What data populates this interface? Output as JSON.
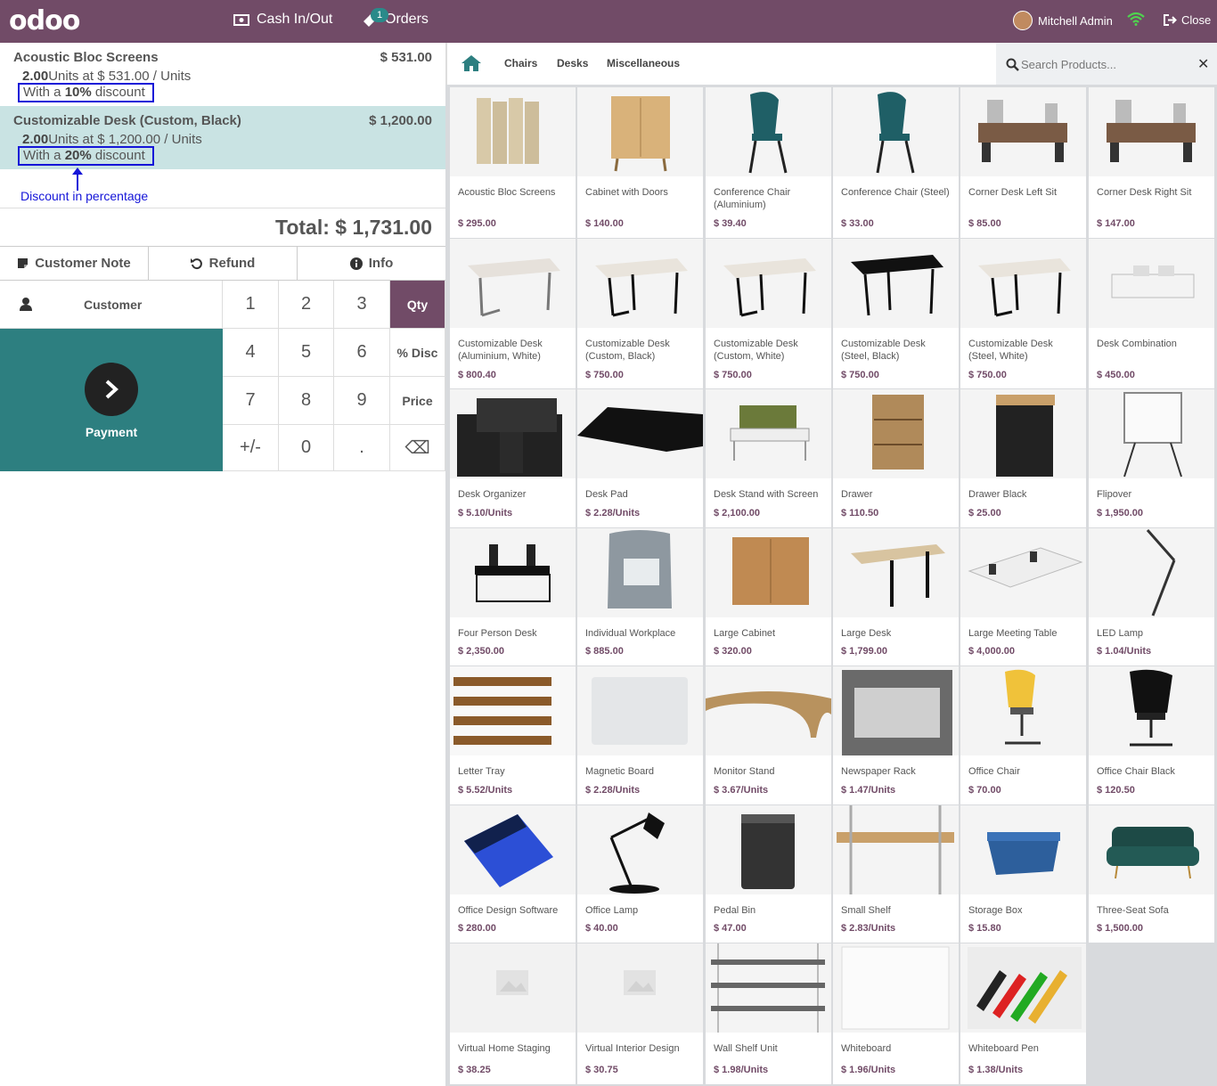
{
  "header": {
    "logo": "odoo",
    "cash_label": "Cash In/Out",
    "orders_label": "Orders",
    "orders_badge": "1",
    "user_name": "Mitchell Admin",
    "close_label": "Close",
    "brand_color": "#714B67"
  },
  "order": {
    "lines": [
      {
        "name": "Acoustic Bloc Screens",
        "price": "$ 531.00",
        "qty": "2.00",
        "info_rest": "Units at $ 531.00 / Units",
        "disc_prefix": "With a ",
        "disc_value": "10%",
        "disc_suffix": " discount"
      },
      {
        "name": "Customizable Desk (Custom, Black)",
        "price": "$ 1,200.00",
        "qty": "2.00",
        "info_rest": "Units at $ 1,200.00 / Units",
        "disc_prefix": "With a ",
        "disc_value": "20%",
        "disc_suffix": " discount"
      }
    ],
    "annotation": "Discount in percentage",
    "total": "Total: $ 1,731.00"
  },
  "controls": {
    "customer_note": "Customer Note",
    "refund": "Refund",
    "info": "Info",
    "customer": "Customer",
    "payment": "Payment"
  },
  "numpad": {
    "keys": [
      "1",
      "2",
      "3",
      "Qty",
      "4",
      "5",
      "6",
      "% Disc",
      "7",
      "8",
      "9",
      "Price",
      "+/-",
      "0",
      ".",
      "⌫"
    ],
    "active_mode": "Qty"
  },
  "categories": [
    "Chairs",
    "Desks",
    "Miscellaneous"
  ],
  "search": {
    "placeholder": "Search Products..."
  },
  "products": [
    {
      "name": "Acoustic Bloc Screens",
      "price": "$ 295.00",
      "icon": "screens"
    },
    {
      "name": "Cabinet with Doors",
      "price": "$ 140.00",
      "icon": "cabinet"
    },
    {
      "name": "Conference Chair (Aluminium)",
      "price": "$ 39.40",
      "icon": "chair-teal"
    },
    {
      "name": "Conference Chair (Steel)",
      "price": "$ 33.00",
      "icon": "chair-teal"
    },
    {
      "name": "Corner Desk Left Sit",
      "price": "$ 85.00",
      "icon": "corner-desk"
    },
    {
      "name": "Corner Desk Right Sit",
      "price": "$ 147.00",
      "icon": "corner-desk"
    },
    {
      "name": "Customizable Desk (Aluminium, White)",
      "price": "$ 800.40",
      "icon": "desk-grey"
    },
    {
      "name": "Customizable Desk (Custom, Black)",
      "price": "$ 750.00",
      "icon": "desk-black-legs"
    },
    {
      "name": "Customizable Desk (Custom, White)",
      "price": "$ 750.00",
      "icon": "desk-black-legs"
    },
    {
      "name": "Customizable Desk (Steel, Black)",
      "price": "$ 750.00",
      "icon": "desk-black"
    },
    {
      "name": "Customizable Desk (Steel, White)",
      "price": "$ 750.00",
      "icon": "desk-black-legs"
    },
    {
      "name": "Desk Combination",
      "price": "$ 450.00",
      "icon": "desk-combo"
    },
    {
      "name": "Desk Organizer",
      "price": "$ 5.10/Units",
      "icon": "organizer"
    },
    {
      "name": "Desk Pad",
      "price": "$ 2.28/Units",
      "icon": "desk-pad"
    },
    {
      "name": "Desk Stand with Screen",
      "price": "$ 2,100.00",
      "icon": "desk-stand"
    },
    {
      "name": "Drawer",
      "price": "$ 110.50",
      "icon": "drawer"
    },
    {
      "name": "Drawer Black",
      "price": "$ 25.00",
      "icon": "drawer-black"
    },
    {
      "name": "Flipover",
      "price": "$ 1,950.00",
      "icon": "flipover"
    },
    {
      "name": "Four Person Desk",
      "price": "$ 2,350.00",
      "icon": "four-desk"
    },
    {
      "name": "Individual Workplace",
      "price": "$ 885.00",
      "icon": "pod"
    },
    {
      "name": "Large Cabinet",
      "price": "$ 320.00",
      "icon": "large-cabinet"
    },
    {
      "name": "Large Desk",
      "price": "$ 1,799.00",
      "icon": "large-desk"
    },
    {
      "name": "Large Meeting Table",
      "price": "$ 4,000.00",
      "icon": "meeting-table"
    },
    {
      "name": "LED Lamp",
      "price": "$ 1.04/Units",
      "icon": "led-lamp"
    },
    {
      "name": "Letter Tray",
      "price": "$ 5.52/Units",
      "icon": "letter-tray"
    },
    {
      "name": "Magnetic Board",
      "price": "$ 2.28/Units",
      "icon": "board"
    },
    {
      "name": "Monitor Stand",
      "price": "$ 3.67/Units",
      "icon": "monitor-stand"
    },
    {
      "name": "Newspaper Rack",
      "price": "$ 1.47/Units",
      "icon": "rack"
    },
    {
      "name": "Office Chair",
      "price": "$ 70.00",
      "icon": "office-chair"
    },
    {
      "name": "Office Chair Black",
      "price": "$ 120.50",
      "icon": "office-chair-black"
    },
    {
      "name": "Office Design Software",
      "price": "$ 280.00",
      "icon": "software"
    },
    {
      "name": "Office Lamp",
      "price": "$ 40.00",
      "icon": "office-lamp"
    },
    {
      "name": "Pedal Bin",
      "price": "$ 47.00",
      "icon": "bin"
    },
    {
      "name": "Small Shelf",
      "price": "$ 2.83/Units",
      "icon": "small-shelf"
    },
    {
      "name": "Storage Box",
      "price": "$ 15.80",
      "icon": "storage-box"
    },
    {
      "name": "Three-Seat Sofa",
      "price": "$ 1,500.00",
      "icon": "sofa"
    },
    {
      "name": "Virtual Home Staging",
      "price": "$ 38.25",
      "icon": "placeholder"
    },
    {
      "name": "Virtual Interior Design",
      "price": "$ 30.75",
      "icon": "placeholder"
    },
    {
      "name": "Wall Shelf Unit",
      "price": "$ 1.98/Units",
      "icon": "wall-shelf"
    },
    {
      "name": "Whiteboard",
      "price": "$ 1.96/Units",
      "icon": "whiteboard"
    },
    {
      "name": "Whiteboard Pen",
      "price": "$ 1.38/Units",
      "icon": "pens"
    }
  ]
}
